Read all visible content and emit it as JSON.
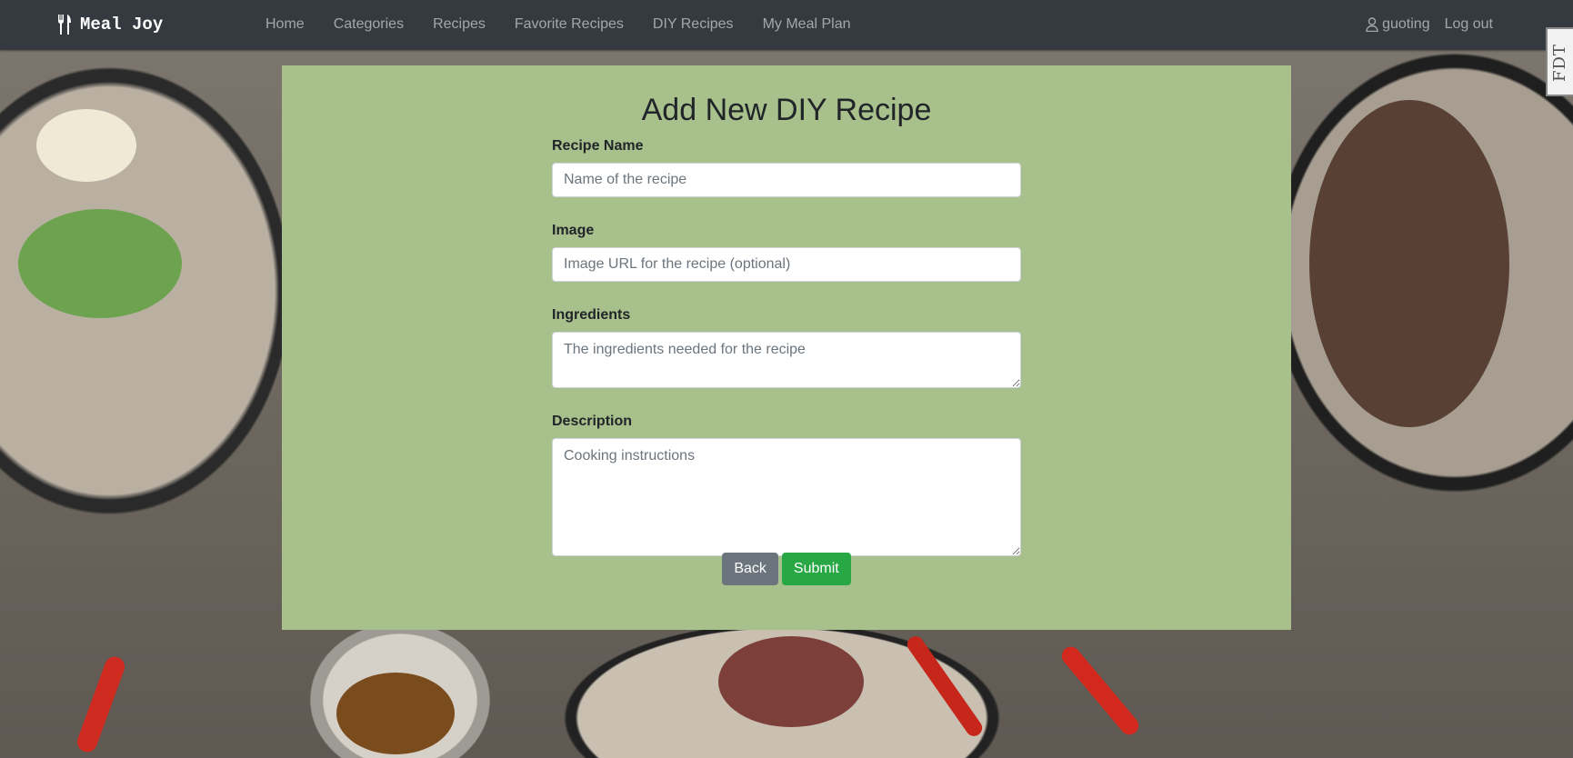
{
  "brand": {
    "name": "Meal Joy",
    "icon": "fork-knife-icon"
  },
  "nav": {
    "links": [
      "Home",
      "Categories",
      "Recipes",
      "Favorite Recipes",
      "DIY Recipes",
      "My Meal Plan"
    ],
    "user": "guoting",
    "logout": "Log out"
  },
  "extension_tab": {
    "label": "FDT"
  },
  "form": {
    "title": "Add New DIY Recipe",
    "recipe_name": {
      "label": "Recipe Name",
      "placeholder": "Name of the recipe",
      "value": ""
    },
    "image": {
      "label": "Image",
      "placeholder": "Image URL for the recipe (optional)",
      "value": ""
    },
    "ingredients": {
      "label": "Ingredients",
      "placeholder": "The ingredients needed for the recipe",
      "value": ""
    },
    "description": {
      "label": "Description",
      "placeholder": "Cooking instructions",
      "value": ""
    },
    "back_label": "Back",
    "submit_label": "Submit"
  },
  "colors": {
    "navbar": "#343a40",
    "panel": "#a8c08b",
    "back_button": "#6c757d",
    "submit_button": "#28a745"
  }
}
